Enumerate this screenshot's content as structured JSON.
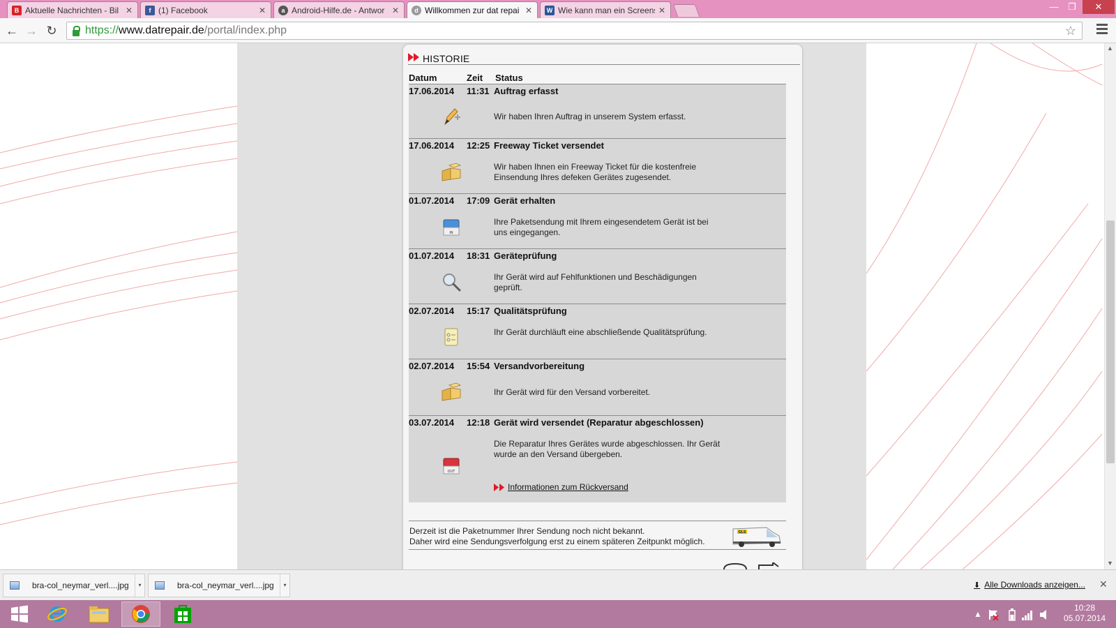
{
  "tabs": [
    {
      "title": "Aktuelle Nachrichten - Bil",
      "icon": "bild-icon"
    },
    {
      "title": "(1) Facebook",
      "icon": "facebook-icon"
    },
    {
      "title": "Android-Hilfe.de - Antwor",
      "icon": "android-icon"
    },
    {
      "title": "Willkommen zur dat repai",
      "icon": "datrepair-icon"
    },
    {
      "title": "Wie kann man ein Screens",
      "icon": "word-icon"
    }
  ],
  "window": {
    "minimize": "—",
    "restore": "❐",
    "close": "✕"
  },
  "toolbar": {
    "url_scheme": "https://",
    "url_host": "www.datrepair.de",
    "url_path": "/portal/index.php",
    "back": "←",
    "forward": "→",
    "reload": "↻",
    "star": "☆"
  },
  "historie": {
    "title": "HISTORIE",
    "col_datum": "Datum",
    "col_zeit": "Zeit",
    "col_status": "Status",
    "entries": [
      {
        "date": "17.06.2014",
        "time": "11:31",
        "status": "Auftrag erfasst",
        "desc": "Wir haben Ihren Auftrag in unserem System erfasst.",
        "icon": "pencil-plus-icon"
      },
      {
        "date": "17.06.2014",
        "time": "12:25",
        "status": "Freeway Ticket versendet",
        "desc": "Wir haben Ihnen ein Freeway Ticket für die kostenfreie Einsendung Ihres defeken Gerätes zugesendet.",
        "icon": "packages-icon"
      },
      {
        "date": "01.07.2014",
        "time": "17:09",
        "status": "Gerät erhalten",
        "desc": "Ihre Paketsendung mit Ihrem eingesendetem Gerät ist bei uns eingegangen.",
        "icon": "inbox-in-icon"
      },
      {
        "date": "01.07.2014",
        "time": "18:31",
        "status": "Geräteprüfung",
        "desc": "Ihr Gerät wird auf Fehlfunktionen und Beschädigungen geprüft.",
        "icon": "magnifier-icon"
      },
      {
        "date": "02.07.2014",
        "time": "15:17",
        "status": "Qualitätsprüfung",
        "desc": "Ihr Gerät durchläuft eine abschließende Qualitätsprüfung.",
        "icon": "checklist-icon"
      },
      {
        "date": "02.07.2014",
        "time": "15:54",
        "status": "Versandvorbereitung",
        "desc": "Ihr Gerät wird für den Versand vorbereitet.",
        "icon": "packages-icon"
      },
      {
        "date": "03.07.2014",
        "time": "12:18",
        "status": "Gerät wird versendet (Reparatur abgeschlossen)",
        "desc": "Die Reparatur Ihres Gerätes wurde abgeschlossen. Ihr Gerät wurde an den Versand übergeben.",
        "icon": "outbox-out-icon",
        "link": "Informationen zum Rückversand"
      }
    ]
  },
  "shipping": {
    "line1": "Derzeit ist die Paketnummer Ihrer Sendung noch nicht bekannt.",
    "line2": "Daher wird eine Sendungsverfolgung erst zu einem späteren Zeitpunkt möglich.",
    "van_label": "GLS"
  },
  "icon_labels": {
    "in": "IN",
    "out": "OUT"
  },
  "downloads": {
    "items": [
      {
        "name": "bra-col_neymar_verl....jpg"
      },
      {
        "name": "bra-col_neymar_verl....jpg"
      }
    ],
    "show_all": "Alle Downloads anzeigen...",
    "close": "✕"
  },
  "taskbar": {
    "time": "10:28",
    "date": "05.07.2014"
  },
  "colors": {
    "tabstrip": "#e592c0",
    "taskbar": "#b27a9e",
    "accent_red": "#e0192a",
    "entry_bg": "#d7d7d7"
  }
}
